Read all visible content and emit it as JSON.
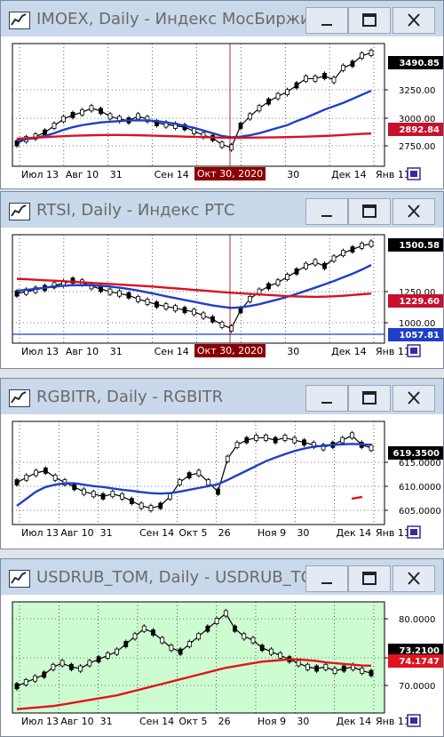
{
  "windows": [
    {
      "title": "IMOEX, Daily - Индекс МосБиржи",
      "bg": "#ffffff",
      "axis_labels": [
        "3250.00",
        "3000.00",
        "2750.00"
      ],
      "price_label": "3490.85",
      "red_label": "2892.84",
      "red_label_color": "#c8102e",
      "crosshair_date": "Окт 30, 2020",
      "x_ticks": [
        "Июл 13",
        "Авг 10",
        "31",
        "Сен 14",
        "Ок",
        "9",
        "30",
        "Дек 14",
        "Янв 11"
      ],
      "chart_data": {
        "type": "line",
        "ylabel": "",
        "ylim": [
          2650,
          3560
        ],
        "series": [
          {
            "values": [
              2820,
              2850,
              2870,
              2900,
              2950,
              3000,
              3030,
              3050,
              3080,
              3060,
              3020,
              3000,
              2990,
              3020,
              3000,
              2970,
              2960,
              2950,
              2940,
              2910,
              2880,
              2860,
              2810,
              2790,
              2950,
              3020,
              3080,
              3130,
              3170,
              3200,
              3250,
              3300,
              3300,
              3320,
              3290,
              3380,
              3410,
              3470,
              3491
            ]
          },
          {
            "values": [
              2840,
              2850,
              2860,
              2875,
              2895,
              2920,
              2940,
              2955,
              2965,
              2975,
              2980,
              2985,
              2990,
              2990,
              2990,
              2985,
              2975,
              2965,
              2950,
              2935,
              2915,
              2895,
              2875,
              2865,
              2870,
              2880,
              2895,
              2915,
              2935,
              2955,
              2985,
              3010,
              3040,
              3070,
              3095,
              3120,
              3150,
              3180,
              3210
            ]
          },
          {
            "values": [
              2855,
              2858,
              2862,
              2866,
              2870,
              2873,
              2876,
              2878,
              2880,
              2881,
              2882,
              2882,
              2881,
              2880,
              2878,
              2876,
              2874,
              2872,
              2870,
              2868,
              2866,
              2864,
              2862,
              2861,
              2861,
              2862,
              2863,
              2864,
              2865,
              2866,
              2868,
              2870,
              2872,
              2875,
              2878,
              2882,
              2886,
              2890,
              2893
            ]
          }
        ]
      }
    },
    {
      "title": "RTSI, Daily - Индекс РТС",
      "bg": "#ffffff",
      "axis_labels": [
        "1250.00",
        "1000.00"
      ],
      "price_label": "1500.58",
      "red_label": "1229.60",
      "red_label_color": "#c8102e",
      "blue_label": "1057.81",
      "crosshair_date": "Окт 30, 2020",
      "x_ticks": [
        "Июл 13",
        "Авг 10",
        "31",
        "Сен 14",
        "Ок",
        "9",
        "30",
        "Дек 14",
        "Янв 11"
      ],
      "chart_data": {
        "type": "line",
        "ylabel": "",
        "ylim": [
          960,
          1550
        ],
        "series": [
          {
            "values": [
              1230,
              1240,
              1250,
              1260,
              1275,
              1285,
              1300,
              1290,
              1270,
              1255,
              1240,
              1230,
              1220,
              1200,
              1185,
              1170,
              1160,
              1150,
              1140,
              1130,
              1110,
              1090,
              1060,
              1040,
              1140,
              1200,
              1240,
              1270,
              1290,
              1320,
              1350,
              1380,
              1400,
              1380,
              1420,
              1450,
              1470,
              1490,
              1501
            ]
          },
          {
            "values": [
              1245,
              1250,
              1255,
              1262,
              1268,
              1272,
              1275,
              1276,
              1275,
              1272,
              1268,
              1262,
              1255,
              1246,
              1236,
              1226,
              1215,
              1205,
              1195,
              1185,
              1175,
              1165,
              1158,
              1152,
              1155,
              1162,
              1172,
              1185,
              1198,
              1212,
              1228,
              1245,
              1262,
              1280,
              1298,
              1318,
              1338,
              1360,
              1385
            ]
          },
          {
            "values": [
              1310,
              1308,
              1305,
              1302,
              1300,
              1297,
              1294,
              1291,
              1288,
              1285,
              1282,
              1279,
              1276,
              1273,
              1270,
              1266,
              1262,
              1258,
              1254,
              1250,
              1246,
              1242,
              1238,
              1234,
              1231,
              1228,
              1225,
              1222,
              1219,
              1216,
              1214,
              1213,
              1212,
              1213,
              1215,
              1218,
              1222,
              1226,
              1230
            ]
          }
        ]
      }
    },
    {
      "title": "RGBITR, Daily - RGBITR",
      "bg": "#ffffff",
      "axis_labels": [
        "615.0000",
        "610.0000",
        "605.0000"
      ],
      "price_label": "619.3500",
      "x_ticks": [
        "Июл 13",
        "Авг 10",
        "31",
        "Сен 14",
        "Окт 5",
        "26",
        "Ноя 9",
        "30",
        "Дек 14",
        "Янв 11"
      ],
      "chart_data": {
        "type": "line",
        "ylabel": "",
        "ylim": [
          603,
          625
        ],
        "series": [
          {
            "values": [
              612,
              613,
              614,
              614.5,
              613,
              612,
              611,
              610,
              609.5,
              609,
              609.5,
              609,
              608,
              607,
              606.5,
              607,
              609,
              612,
              613.5,
              614,
              612,
              610,
              617,
              620,
              621,
              621.5,
              621.5,
              621,
              621.5,
              621,
              620.5,
              620,
              619.5,
              620,
              621,
              622,
              620,
              619.35
            ]
          },
          {
            "values": [
              607,
              608.5,
              610,
              611,
              611.5,
              611.8,
              611.8,
              611.5,
              611.2,
              611,
              610.7,
              610.4,
              610.2,
              609.9,
              609.7,
              609.6,
              609.7,
              610,
              610.4,
              610.8,
              611.2,
              611.6,
              612.5,
              613.5,
              614.5,
              615.5,
              616.5,
              617.3,
              618,
              618.7,
              619.2,
              619.6,
              619.8,
              620,
              620.1,
              620.2,
              620.1,
              620
            ]
          },
          {
            "values": [
              608.5,
              608.7,
              608.9
            ]
          }
        ]
      }
    },
    {
      "title": "USDRUB_TOM, Daily - USDRUB_TOM",
      "bg": "#cdfcd0",
      "axis_labels": [
        "80.0000",
        "75.0000",
        "70.0000"
      ],
      "price_label": "73.2100",
      "red_label": "74.1747",
      "red_label_color": "#e0141e",
      "x_ticks": [
        "Июл 13",
        "Авг 10",
        "31",
        "Сен 14",
        "Окт 5",
        "26",
        "Ноя 9",
        "30",
        "Дек 14",
        "Янв 11"
      ],
      "chart_data": {
        "type": "line",
        "ylabel": "",
        "ylim": [
          68,
          82.5
        ],
        "series": [
          {
            "values": [
              71.5,
              72,
              72.5,
              73,
              74,
              74.5,
              74,
              73.8,
              74.5,
              75,
              75.5,
              76,
              77,
              78,
              79,
              78.5,
              77.5,
              76.5,
              76,
              77,
              78,
              79,
              80,
              81,
              79,
              78,
              77.5,
              76.5,
              76,
              75.5,
              75,
              74.5,
              74,
              73.8,
              74,
              73.5,
              73.8,
              74,
              73.5,
              73.21
            ]
          },
          {
            "values": [
              68.5,
              68.6,
              68.7,
              68.8,
              68.9,
              69.1,
              69.3,
              69.5,
              69.7,
              69.9,
              70.1,
              70.3,
              70.6,
              70.9,
              71.2,
              71.5,
              71.8,
              72.1,
              72.4,
              72.7,
              73,
              73.3,
              73.6,
              73.9,
              74.1,
              74.3,
              74.5,
              74.7,
              74.8,
              74.9,
              75,
              75,
              74.9,
              74.8,
              74.6,
              74.5,
              74.4,
              74.3,
              74.2,
              74.17
            ]
          }
        ]
      }
    }
  ]
}
